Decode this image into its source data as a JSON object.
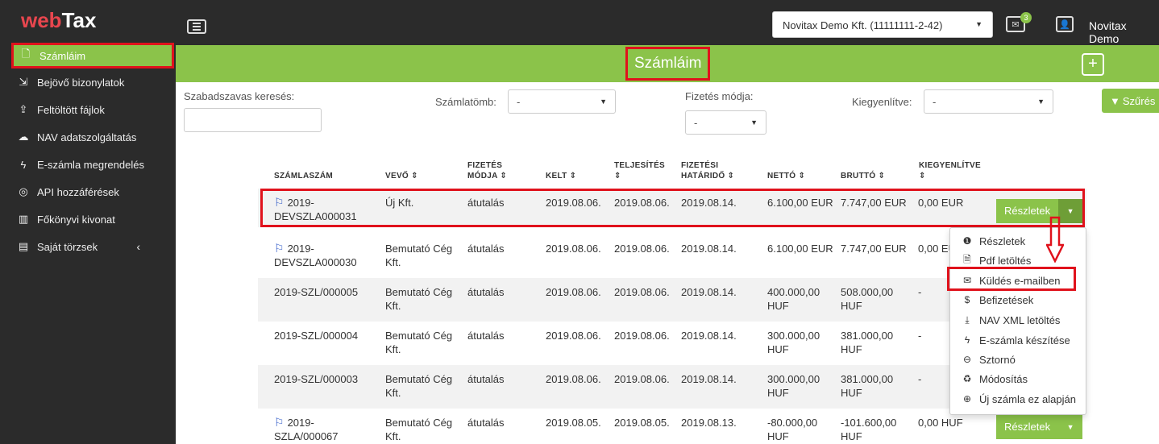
{
  "app": {
    "logo_part1": "web",
    "logo_part2": "Tax"
  },
  "sidebar": {
    "items": [
      {
        "label": "Számláim",
        "icon": "file-icon"
      },
      {
        "label": "Bejövő bizonylatok",
        "icon": "inbox-icon"
      },
      {
        "label": "Feltöltött fájlok",
        "icon": "upload-icon"
      },
      {
        "label": "NAV adatszolgáltatás",
        "icon": "cloud-icon"
      },
      {
        "label": "E-számla megrendelés",
        "icon": "bolt-icon"
      },
      {
        "label": "API hozzáférések",
        "icon": "fingerprint-icon"
      },
      {
        "label": "Főkönyvi kivonat",
        "icon": "bar-chart-icon"
      },
      {
        "label": "Saját törzsek",
        "icon": "book-icon",
        "chevron": "‹"
      }
    ]
  },
  "topbar": {
    "company": "Novitax Demo Kft. (11111111-2-42)",
    "mail_count": "3",
    "user": "Novitax Demo"
  },
  "page": {
    "title": "Számláim",
    "add_label": "+"
  },
  "filters": {
    "search_label": "Szabadszavas keresés:",
    "search_value": "",
    "szamlatomb_label": "Számlatömb:",
    "szamlatomb_value": "-",
    "fizetes_label": "Fizetés módja:",
    "fizetes_value": "-",
    "kiegyenlitve_label": "Kiegyenlítve:",
    "kiegyenlitve_value": "-",
    "filter_button": "Szűrés"
  },
  "table": {
    "headers": {
      "szamlaszam": "SZÁMLASZÁM",
      "vevo": "VEVŐ ⇕",
      "fizetes1": "FIZETÉS",
      "fizetes2": "MÓDJA ⇕",
      "kelt": "KELT ⇕",
      "teljesites1": "TELJESÍTÉS",
      "teljesites2": "⇕",
      "hatarido1": "FIZETÉSI",
      "hatarido2": "HATÁRIDŐ ⇕",
      "netto": "NETTÓ ⇕",
      "brutto": "BRUTTÓ ⇕",
      "kiegyenlitve1": "KIEGYENLÍTVE",
      "kiegyenlitve2": "⇕"
    },
    "rows": [
      {
        "id1": "2019-",
        "id2": "DEVSZLA000031",
        "flag": true,
        "vevo1": "Új Kft.",
        "vevo2": "",
        "fizetes": "átutalás",
        "kelt": "2019.08.06.",
        "telj": "2019.08.06.",
        "hatarido": "2019.08.14.",
        "netto1": "6.100,00 EUR",
        "netto2": "",
        "brutto1": "7.747,00 EUR",
        "brutto2": "",
        "kiegy": "0,00 EUR",
        "details": "Részletek"
      },
      {
        "id1": "2019-",
        "id2": "DEVSZLA000030",
        "flag": true,
        "vevo1": "Bemutató Cég",
        "vevo2": "Kft.",
        "fizetes": "átutalás",
        "kelt": "2019.08.06.",
        "telj": "2019.08.06.",
        "hatarido": "2019.08.14.",
        "netto1": "6.100,00 EUR",
        "netto2": "",
        "brutto1": "7.747,00 EUR",
        "brutto2": "",
        "kiegy": "0,00 EU",
        "details": ""
      },
      {
        "id1": "2019-SZL/000005",
        "id2": "",
        "flag": false,
        "vevo1": "Bemutató Cég",
        "vevo2": "Kft.",
        "fizetes": "átutalás",
        "kelt": "2019.08.06.",
        "telj": "2019.08.06.",
        "hatarido": "2019.08.14.",
        "netto1": "400.000,00",
        "netto2": "HUF",
        "brutto1": "508.000,00",
        "brutto2": "HUF",
        "kiegy": "-",
        "details": ""
      },
      {
        "id1": "2019-SZL/000004",
        "id2": "",
        "flag": false,
        "vevo1": "Bemutató Cég",
        "vevo2": "Kft.",
        "fizetes": "átutalás",
        "kelt": "2019.08.06.",
        "telj": "2019.08.06.",
        "hatarido": "2019.08.14.",
        "netto1": "300.000,00",
        "netto2": "HUF",
        "brutto1": "381.000,00",
        "brutto2": "HUF",
        "kiegy": "-",
        "details": ""
      },
      {
        "id1": "2019-SZL/000003",
        "id2": "",
        "flag": false,
        "vevo1": "Bemutató Cég",
        "vevo2": "Kft.",
        "fizetes": "átutalás",
        "kelt": "2019.08.06.",
        "telj": "2019.08.06.",
        "hatarido": "2019.08.14.",
        "netto1": "300.000,00",
        "netto2": "HUF",
        "brutto1": "381.000,00",
        "brutto2": "HUF",
        "kiegy": "-",
        "details": ""
      },
      {
        "id1": "2019-",
        "id2": "SZLA/000067",
        "flag": true,
        "vevo1": "Bemutató Cég",
        "vevo2": "Kft.",
        "fizetes": "átutalás",
        "kelt": "2019.08.05.",
        "telj": "2019.08.05.",
        "hatarido": "2019.08.13.",
        "netto1": "-80.000,00",
        "netto2": "HUF",
        "brutto1": "-101.600,00",
        "brutto2": "HUF",
        "kiegy": "0,00 HUF",
        "details": "Részletek"
      }
    ]
  },
  "dropdown": {
    "items": [
      {
        "label": "Részletek",
        "icon": "info-icon"
      },
      {
        "label": "Pdf letöltés",
        "icon": "pdf-icon"
      },
      {
        "label": "Küldés e-mailben",
        "icon": "envelope-icon"
      },
      {
        "label": "Befizetések",
        "icon": "dollar-icon"
      },
      {
        "label": "NAV XML letöltés",
        "icon": "download-icon"
      },
      {
        "label": "E-számla készítése",
        "icon": "bolt-icon"
      },
      {
        "label": "Sztornó",
        "icon": "minus-circle-icon"
      },
      {
        "label": "Módosítás",
        "icon": "recycle-icon"
      },
      {
        "label": "Új számla ez alapján",
        "icon": "plus-circle-icon"
      }
    ]
  },
  "colors": {
    "accent": "#8bc34a",
    "sidebar": "#2b2b2b",
    "highlight": "#e0121c",
    "flag": "#2a56c6"
  }
}
